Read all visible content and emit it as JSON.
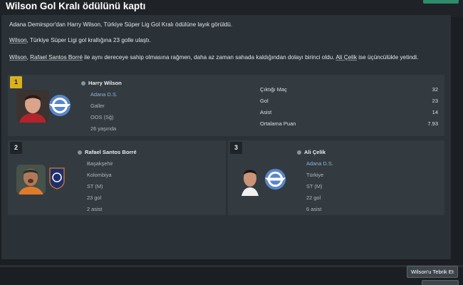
{
  "header": {
    "title": "Wilson Gol Kralı ödülünü kaptı"
  },
  "body": {
    "para1": "Adana Demirspor'dan Harry Wilson, Türkiye Süper Lig Gol Kralı ödülüne layık görüldü.",
    "para2_link": "Wilson",
    "para2_rest": ", Türkiye Süper Ligi gol krallığına 23 golle ulaştı.",
    "para3_link1": "Wilson",
    "para3_sep": ", ",
    "para3_link2": "Rafael Santos Borré",
    "para3_mid": " ile aynı dereceye sahip olmasına rağmen, daha az zaman sahada kaldığından dolayı birinci oldu. ",
    "para3_link3": "Ali Çelik",
    "para3_end": " ise üçüncülükle yetindi."
  },
  "first": {
    "rank": "1",
    "name": "Harry Wilson",
    "club": "Adana D.S.",
    "nation": "Galler",
    "position": "OOS (Sğ)",
    "age": "26 yaşında",
    "stats": [
      {
        "label": "Çıktığı Maç",
        "value": "32"
      },
      {
        "label": "Gol",
        "value": "23"
      },
      {
        "label": "Asist",
        "value": "14"
      },
      {
        "label": "Ortalama Puan",
        "value": "7.93"
      }
    ]
  },
  "second": {
    "rank": "2",
    "name": "Rafael Santos Borré",
    "club": "Başakşehir",
    "nation": "Kolombiya",
    "position": "ST (M)",
    "goals": "23 gol",
    "assists": "2 asist"
  },
  "third": {
    "rank": "3",
    "name": "Ali Çelik",
    "club": "Adana D.S.",
    "nation": "Türkiye",
    "position": "ST (M)",
    "goals": "22 gol",
    "assists": "6 asist"
  },
  "actions": {
    "congratulate": "Wilson'u Tebrik Et"
  },
  "colors": {
    "accent_gold": "#d8b21c",
    "link_blue": "#8fb2d6",
    "adana_blue": "#5a86c8",
    "basaksehir_navy": "#1e2f6b"
  }
}
